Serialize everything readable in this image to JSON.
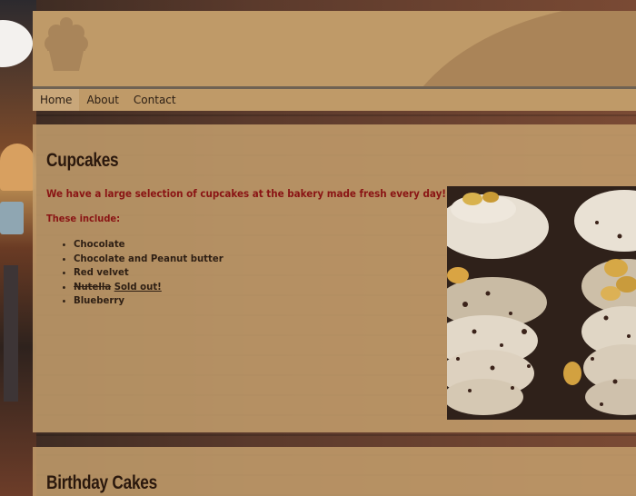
{
  "nav": {
    "items": [
      "Home",
      "About",
      "Contact"
    ],
    "active": "Home"
  },
  "cupcakes": {
    "title": "Cupcakes",
    "intro": "We have a large selection of cupcakes at the bakery made fresh every day!",
    "includes_label": "These include:",
    "flavors": {
      "chocolate": "Chocolate",
      "choc_peanut": "Chocolate and Peanut butter",
      "red_velvet": "Red velvet",
      "nutella": "Nutella",
      "sold_out": "Sold out!",
      "blueberry": "Blueberry"
    }
  },
  "birthday": {
    "title": "Birthday Cakes"
  },
  "colors": {
    "accent": "#8a1414",
    "header": "#bf9a68",
    "panel": "#c49e6c",
    "heading": "#2a180d"
  },
  "icons": {
    "logo": "cupcake-logo-icon"
  }
}
